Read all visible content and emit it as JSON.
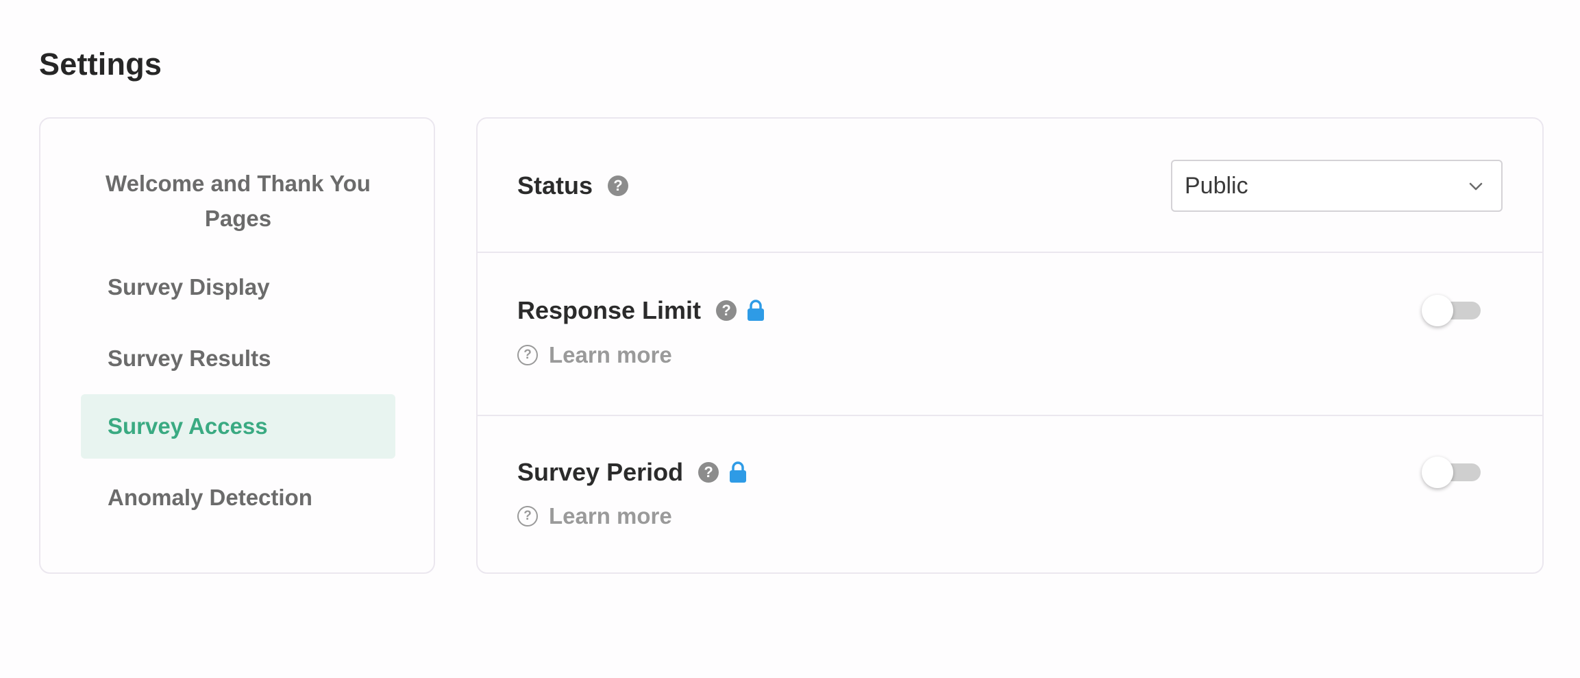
{
  "page": {
    "title": "Settings"
  },
  "sidebar": {
    "items": [
      {
        "label": "Welcome and Thank You Pages",
        "active": false
      },
      {
        "label": "Survey Display",
        "active": false
      },
      {
        "label": "Survey Results",
        "active": false
      },
      {
        "label": "Survey Access",
        "active": true
      },
      {
        "label": "Anomaly Detection",
        "active": false
      }
    ]
  },
  "panel": {
    "status": {
      "label": "Status",
      "help_icon": "help-icon",
      "select_value": "Public"
    },
    "response_limit": {
      "label": "Response Limit",
      "help_icon": "help-icon",
      "lock_icon": "lock-icon",
      "learn_more": "Learn more",
      "toggle_on": false
    },
    "survey_period": {
      "label": "Survey Period",
      "help_icon": "help-icon",
      "lock_icon": "lock-icon",
      "learn_more": "Learn more",
      "toggle_on": false
    }
  },
  "colors": {
    "accent": "#3aaa82",
    "active_bg": "#e8f4f0",
    "lock": "#2e9be6",
    "border": "#ebe7ef"
  }
}
